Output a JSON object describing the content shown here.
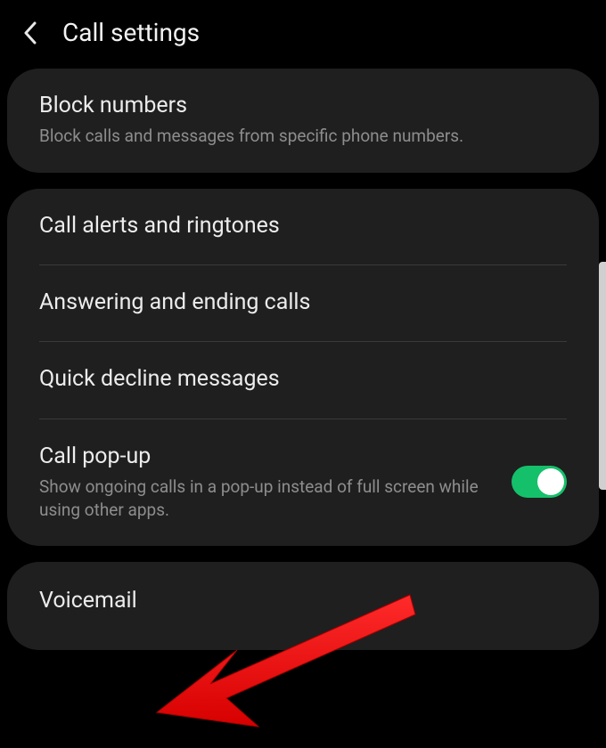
{
  "header": {
    "title": "Call settings"
  },
  "sections": {
    "block": {
      "title": "Block numbers",
      "subtitle": "Block calls and messages from specific phone numbers."
    },
    "alerts": {
      "title": "Call alerts and ringtones"
    },
    "answering": {
      "title": "Answering and ending calls"
    },
    "decline": {
      "title": "Quick decline messages"
    },
    "popup": {
      "title": "Call pop-up",
      "subtitle": "Show ongoing calls in a pop-up instead of full screen while using other apps.",
      "toggle_on": true
    },
    "voicemail": {
      "title": "Voicemail"
    }
  },
  "colors": {
    "toggle_on": "#15c06a",
    "annotation_arrow": "#ff0000"
  }
}
